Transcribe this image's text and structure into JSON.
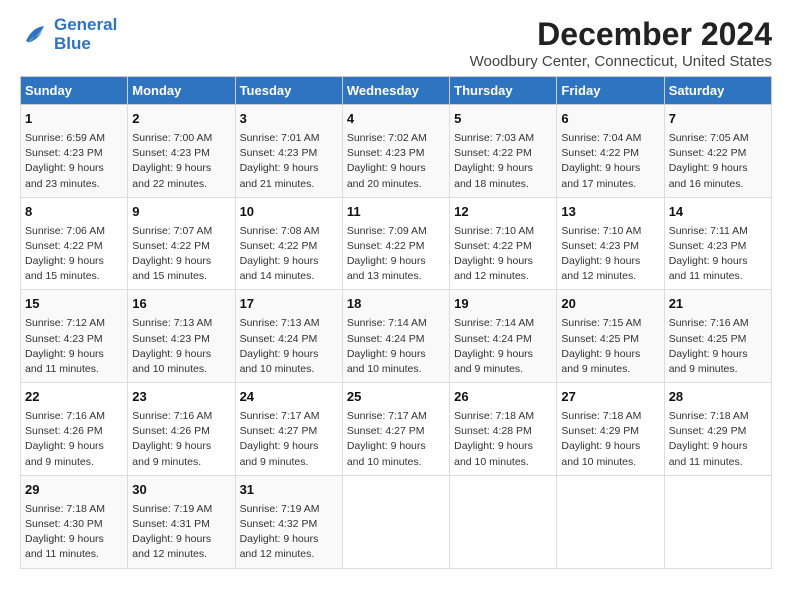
{
  "logo": {
    "line1": "General",
    "line2": "Blue"
  },
  "title": "December 2024",
  "subtitle": "Woodbury Center, Connecticut, United States",
  "days_of_week": [
    "Sunday",
    "Monday",
    "Tuesday",
    "Wednesday",
    "Thursday",
    "Friday",
    "Saturday"
  ],
  "weeks": [
    [
      {
        "day": "1",
        "sunrise": "Sunrise: 6:59 AM",
        "sunset": "Sunset: 4:23 PM",
        "daylight": "Daylight: 9 hours and 23 minutes."
      },
      {
        "day": "2",
        "sunrise": "Sunrise: 7:00 AM",
        "sunset": "Sunset: 4:23 PM",
        "daylight": "Daylight: 9 hours and 22 minutes."
      },
      {
        "day": "3",
        "sunrise": "Sunrise: 7:01 AM",
        "sunset": "Sunset: 4:23 PM",
        "daylight": "Daylight: 9 hours and 21 minutes."
      },
      {
        "day": "4",
        "sunrise": "Sunrise: 7:02 AM",
        "sunset": "Sunset: 4:23 PM",
        "daylight": "Daylight: 9 hours and 20 minutes."
      },
      {
        "day": "5",
        "sunrise": "Sunrise: 7:03 AM",
        "sunset": "Sunset: 4:22 PM",
        "daylight": "Daylight: 9 hours and 18 minutes."
      },
      {
        "day": "6",
        "sunrise": "Sunrise: 7:04 AM",
        "sunset": "Sunset: 4:22 PM",
        "daylight": "Daylight: 9 hours and 17 minutes."
      },
      {
        "day": "7",
        "sunrise": "Sunrise: 7:05 AM",
        "sunset": "Sunset: 4:22 PM",
        "daylight": "Daylight: 9 hours and 16 minutes."
      }
    ],
    [
      {
        "day": "8",
        "sunrise": "Sunrise: 7:06 AM",
        "sunset": "Sunset: 4:22 PM",
        "daylight": "Daylight: 9 hours and 15 minutes."
      },
      {
        "day": "9",
        "sunrise": "Sunrise: 7:07 AM",
        "sunset": "Sunset: 4:22 PM",
        "daylight": "Daylight: 9 hours and 15 minutes."
      },
      {
        "day": "10",
        "sunrise": "Sunrise: 7:08 AM",
        "sunset": "Sunset: 4:22 PM",
        "daylight": "Daylight: 9 hours and 14 minutes."
      },
      {
        "day": "11",
        "sunrise": "Sunrise: 7:09 AM",
        "sunset": "Sunset: 4:22 PM",
        "daylight": "Daylight: 9 hours and 13 minutes."
      },
      {
        "day": "12",
        "sunrise": "Sunrise: 7:10 AM",
        "sunset": "Sunset: 4:22 PM",
        "daylight": "Daylight: 9 hours and 12 minutes."
      },
      {
        "day": "13",
        "sunrise": "Sunrise: 7:10 AM",
        "sunset": "Sunset: 4:23 PM",
        "daylight": "Daylight: 9 hours and 12 minutes."
      },
      {
        "day": "14",
        "sunrise": "Sunrise: 7:11 AM",
        "sunset": "Sunset: 4:23 PM",
        "daylight": "Daylight: 9 hours and 11 minutes."
      }
    ],
    [
      {
        "day": "15",
        "sunrise": "Sunrise: 7:12 AM",
        "sunset": "Sunset: 4:23 PM",
        "daylight": "Daylight: 9 hours and 11 minutes."
      },
      {
        "day": "16",
        "sunrise": "Sunrise: 7:13 AM",
        "sunset": "Sunset: 4:23 PM",
        "daylight": "Daylight: 9 hours and 10 minutes."
      },
      {
        "day": "17",
        "sunrise": "Sunrise: 7:13 AM",
        "sunset": "Sunset: 4:24 PM",
        "daylight": "Daylight: 9 hours and 10 minutes."
      },
      {
        "day": "18",
        "sunrise": "Sunrise: 7:14 AM",
        "sunset": "Sunset: 4:24 PM",
        "daylight": "Daylight: 9 hours and 10 minutes."
      },
      {
        "day": "19",
        "sunrise": "Sunrise: 7:14 AM",
        "sunset": "Sunset: 4:24 PM",
        "daylight": "Daylight: 9 hours and 9 minutes."
      },
      {
        "day": "20",
        "sunrise": "Sunrise: 7:15 AM",
        "sunset": "Sunset: 4:25 PM",
        "daylight": "Daylight: 9 hours and 9 minutes."
      },
      {
        "day": "21",
        "sunrise": "Sunrise: 7:16 AM",
        "sunset": "Sunset: 4:25 PM",
        "daylight": "Daylight: 9 hours and 9 minutes."
      }
    ],
    [
      {
        "day": "22",
        "sunrise": "Sunrise: 7:16 AM",
        "sunset": "Sunset: 4:26 PM",
        "daylight": "Daylight: 9 hours and 9 minutes."
      },
      {
        "day": "23",
        "sunrise": "Sunrise: 7:16 AM",
        "sunset": "Sunset: 4:26 PM",
        "daylight": "Daylight: 9 hours and 9 minutes."
      },
      {
        "day": "24",
        "sunrise": "Sunrise: 7:17 AM",
        "sunset": "Sunset: 4:27 PM",
        "daylight": "Daylight: 9 hours and 9 minutes."
      },
      {
        "day": "25",
        "sunrise": "Sunrise: 7:17 AM",
        "sunset": "Sunset: 4:27 PM",
        "daylight": "Daylight: 9 hours and 10 minutes."
      },
      {
        "day": "26",
        "sunrise": "Sunrise: 7:18 AM",
        "sunset": "Sunset: 4:28 PM",
        "daylight": "Daylight: 9 hours and 10 minutes."
      },
      {
        "day": "27",
        "sunrise": "Sunrise: 7:18 AM",
        "sunset": "Sunset: 4:29 PM",
        "daylight": "Daylight: 9 hours and 10 minutes."
      },
      {
        "day": "28",
        "sunrise": "Sunrise: 7:18 AM",
        "sunset": "Sunset: 4:29 PM",
        "daylight": "Daylight: 9 hours and 11 minutes."
      }
    ],
    [
      {
        "day": "29",
        "sunrise": "Sunrise: 7:18 AM",
        "sunset": "Sunset: 4:30 PM",
        "daylight": "Daylight: 9 hours and 11 minutes."
      },
      {
        "day": "30",
        "sunrise": "Sunrise: 7:19 AM",
        "sunset": "Sunset: 4:31 PM",
        "daylight": "Daylight: 9 hours and 12 minutes."
      },
      {
        "day": "31",
        "sunrise": "Sunrise: 7:19 AM",
        "sunset": "Sunset: 4:32 PM",
        "daylight": "Daylight: 9 hours and 12 minutes."
      },
      null,
      null,
      null,
      null
    ]
  ]
}
